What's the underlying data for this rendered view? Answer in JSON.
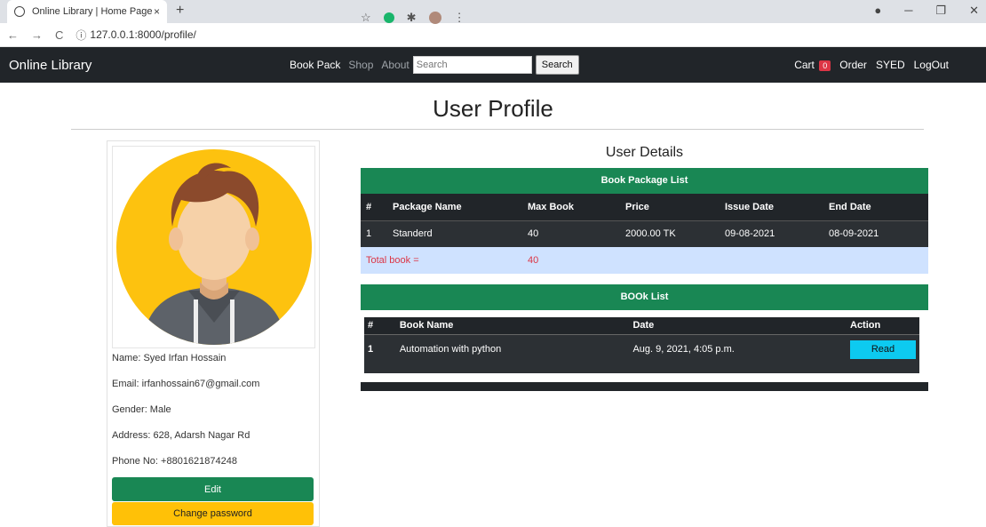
{
  "browser": {
    "tab_title": "Online Library | Home Page",
    "tab_close": "×",
    "new_tab": "+",
    "url": "127.0.0.1:8000/profile/",
    "back": "←",
    "forward": "→",
    "reload": "C"
  },
  "navbar": {
    "brand": "Online Library",
    "links": [
      "Book Pack",
      "Shop",
      "About"
    ],
    "search_placeholder": "Search",
    "search_button": "Search",
    "cart_label": "Cart",
    "cart_count": "0",
    "order": "Order",
    "user": "SYED",
    "logout": "LogOut"
  },
  "page": {
    "title": "User Profile"
  },
  "profile": {
    "name": "Name: Syed Irfan Hossain",
    "email": "Email: irfanhossain67@gmail.com",
    "gender": "Gender: Male",
    "address": "Address: 628, Adarsh Nagar Rd",
    "phone": "Phone No: +8801621874248",
    "edit_button": "Edit",
    "change_password_button": "Change password"
  },
  "details": {
    "title": "User Details",
    "package_table": {
      "heading": "Book Package List",
      "columns": [
        "#",
        "Package Name",
        "Max Book",
        "Price",
        "Issue Date",
        "End Date"
      ],
      "rows": [
        [
          "1",
          "Standerd",
          "40",
          "2000.00 TK",
          "09-08-2021",
          "08-09-2021"
        ]
      ],
      "total_label": "Total book =",
      "total_value": "40"
    },
    "book_table": {
      "heading": "BOOk List",
      "columns": [
        "#",
        "Book Name",
        "Date",
        "Action"
      ],
      "rows": [
        [
          "1",
          "Automation with python",
          "Aug. 9, 2021, 4:05 p.m."
        ]
      ],
      "action_label": "Read"
    }
  },
  "colors": {
    "navbar": "#212529",
    "green": "#198754",
    "yellow": "#ffc107",
    "cyan": "#0dcaf0",
    "badge_red": "#dc3545",
    "total_row": "#cfe2ff"
  }
}
